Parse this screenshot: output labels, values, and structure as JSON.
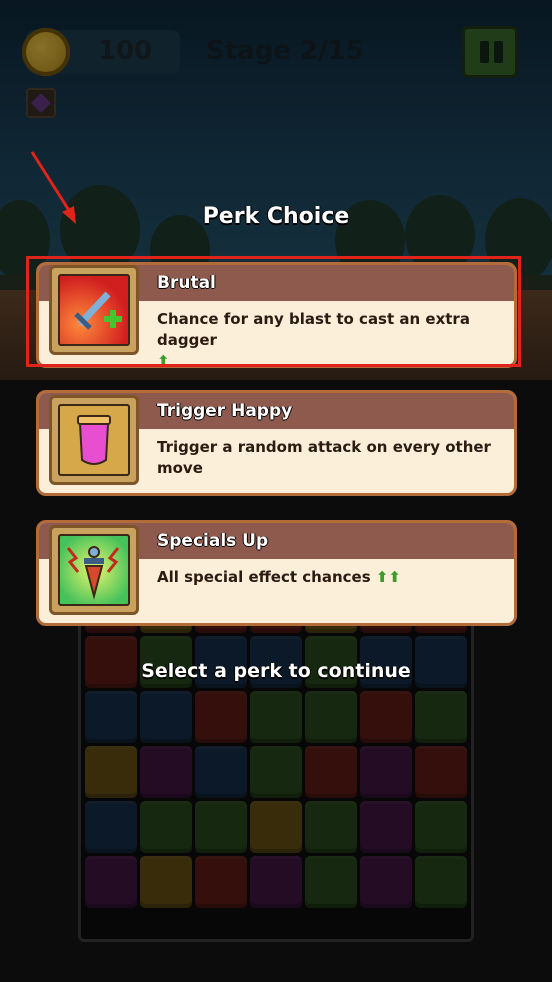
{
  "hud": {
    "coins": "100",
    "stage": "Stage 2/15"
  },
  "modal": {
    "title": "Perk Choice",
    "footer": "Select a perk to continue"
  },
  "perks": [
    {
      "name": "Brutal",
      "description": "Chance for any blast to cast an extra dagger",
      "up_arrows": "⬆",
      "icon": "dagger-plus-icon"
    },
    {
      "name": "Trigger Happy",
      "description": "Trigger a random attack on every other move",
      "up_arrows": "",
      "icon": "potion-icon"
    },
    {
      "name": "Specials Up",
      "description": "All special effect chances",
      "up_arrows": "⬆⬆",
      "icon": "lightning-dagger-icon"
    }
  ],
  "colors": {
    "card_bg": "#fbefd9",
    "card_header": "#8f5a4e",
    "highlight": "#e0241b",
    "up_arrow": "#3f9b2c"
  }
}
